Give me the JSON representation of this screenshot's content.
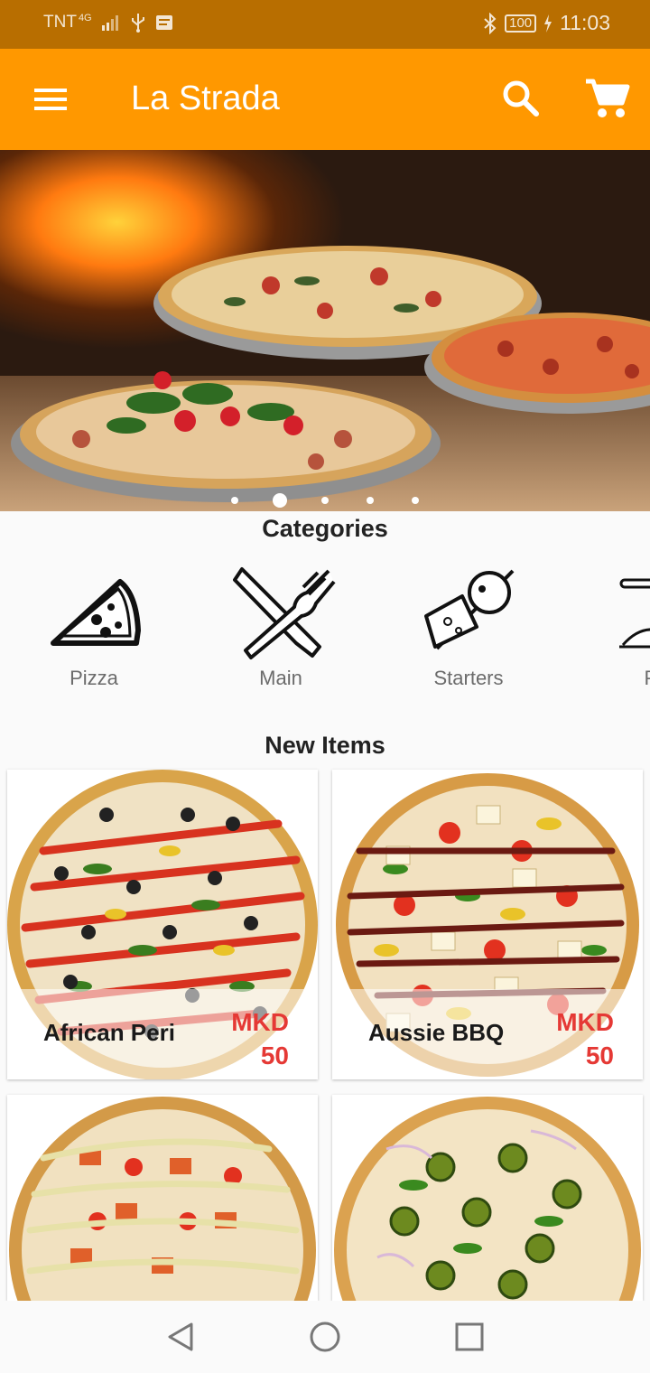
{
  "status_bar": {
    "carrier": "TNT",
    "network": "4G",
    "battery": "100",
    "time": "11:03"
  },
  "app_bar": {
    "title": "La Strada",
    "menu_icon": "menu-icon",
    "search_icon": "search-icon",
    "cart_icon": "cart-icon"
  },
  "carousel": {
    "slides": 5,
    "active_index": 1
  },
  "categories": {
    "title": "Categories",
    "items": [
      {
        "label": "Pizza",
        "icon": "pizza-slice-icon"
      },
      {
        "label": "Main",
        "icon": "knife-fork-icon"
      },
      {
        "label": "Starters",
        "icon": "skewer-icon"
      },
      {
        "label": "Pa",
        "icon": "pasta-plate-icon"
      }
    ]
  },
  "new_items": {
    "title": "New Items",
    "items": [
      {
        "name": "African Peri",
        "currency": "MKD",
        "price": "50"
      },
      {
        "name": "Aussie BBQ",
        "currency": "MKD",
        "price": "50"
      },
      {
        "name": "",
        "currency": "",
        "price": ""
      },
      {
        "name": "",
        "currency": "",
        "price": ""
      }
    ]
  },
  "nav_bar": {
    "back_icon": "back-icon",
    "home_icon": "home-icon",
    "recents_icon": "recents-icon"
  },
  "colors": {
    "primary": "#ff9800",
    "status_bar": "#b86e00",
    "price": "#e53935"
  }
}
